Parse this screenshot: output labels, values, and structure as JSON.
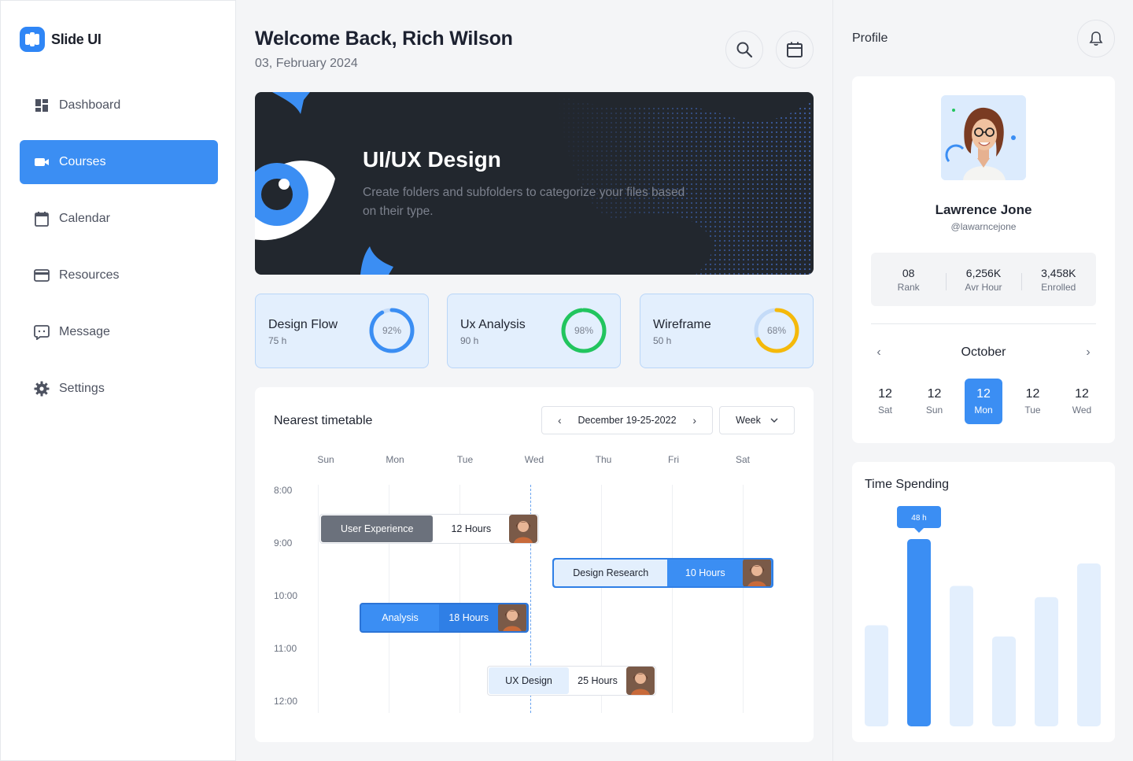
{
  "brand": {
    "name": "Slide UI",
    "accent": "#3b8ef3"
  },
  "sidebar": {
    "items": [
      {
        "label": "Dashboard",
        "icon": "dashboard-icon",
        "active": false
      },
      {
        "label": "Courses",
        "icon": "video-camera-icon",
        "active": true
      },
      {
        "label": "Calendar",
        "icon": "calendar-icon",
        "active": false
      },
      {
        "label": "Resources",
        "icon": "card-icon",
        "active": false
      },
      {
        "label": "Message",
        "icon": "message-icon",
        "active": false
      },
      {
        "label": "Settings",
        "icon": "gear-icon",
        "active": false
      }
    ]
  },
  "header": {
    "title": "Welcome Back, Rich Wilson",
    "date": "03, February 2024"
  },
  "hero": {
    "title": "UI/UX Design",
    "description": "Create folders and subfolders to categorize your files based on their type."
  },
  "stats": [
    {
      "name": "Design Flow",
      "hours": "75 h",
      "percent_label": "92%",
      "percent": 92,
      "color": "#3b8ef3"
    },
    {
      "name": "Ux Analysis",
      "hours": "90 h",
      "percent_label": "98%",
      "percent": 98,
      "color": "#22c55e"
    },
    {
      "name": "Wireframe",
      "hours": "50 h",
      "percent_label": "68%",
      "percent": 68,
      "color": "#f5b90a"
    }
  ],
  "timetable": {
    "title": "Nearest timetable",
    "range": "December 19-25-2022",
    "view": "Week",
    "days": [
      "Sun",
      "Mon",
      "Tue",
      "Wed",
      "Thu",
      "Fri",
      "Sat"
    ],
    "times": [
      "8:00",
      "9:00",
      "10:00",
      "11:00",
      "12:00"
    ],
    "events": [
      {
        "name": "User Experience",
        "hours": "12 Hours"
      },
      {
        "name": "Design Research",
        "hours": "10 Hours"
      },
      {
        "name": "Analysis",
        "hours": "18 Hours"
      },
      {
        "name": "UX Design",
        "hours": "25 Hours"
      }
    ]
  },
  "profile": {
    "title": "Profile",
    "name": "Lawrence Jone",
    "handle": "@lawarncejone",
    "stats": [
      {
        "value": "08",
        "label": "Rank"
      },
      {
        "value": "6,256K",
        "label": "Avr Hour"
      },
      {
        "value": "3,458K",
        "label": "Enrolled"
      }
    ],
    "month": "October",
    "days": [
      {
        "n": "12",
        "w": "Sat",
        "selected": false
      },
      {
        "n": "12",
        "w": "Sun",
        "selected": false
      },
      {
        "n": "12",
        "w": "Mon",
        "selected": true
      },
      {
        "n": "12",
        "w": "Tue",
        "selected": false
      },
      {
        "n": "12",
        "w": "Wed",
        "selected": false
      }
    ]
  },
  "time_spending": {
    "title": "Time Spending",
    "tooltip": "48 h",
    "bars": [
      {
        "value": 0.54,
        "highlight": false
      },
      {
        "value": 1.0,
        "highlight": true
      },
      {
        "value": 0.75,
        "highlight": false
      },
      {
        "value": 0.48,
        "highlight": false
      },
      {
        "value": 0.69,
        "highlight": false
      },
      {
        "value": 0.87,
        "highlight": false
      }
    ]
  }
}
